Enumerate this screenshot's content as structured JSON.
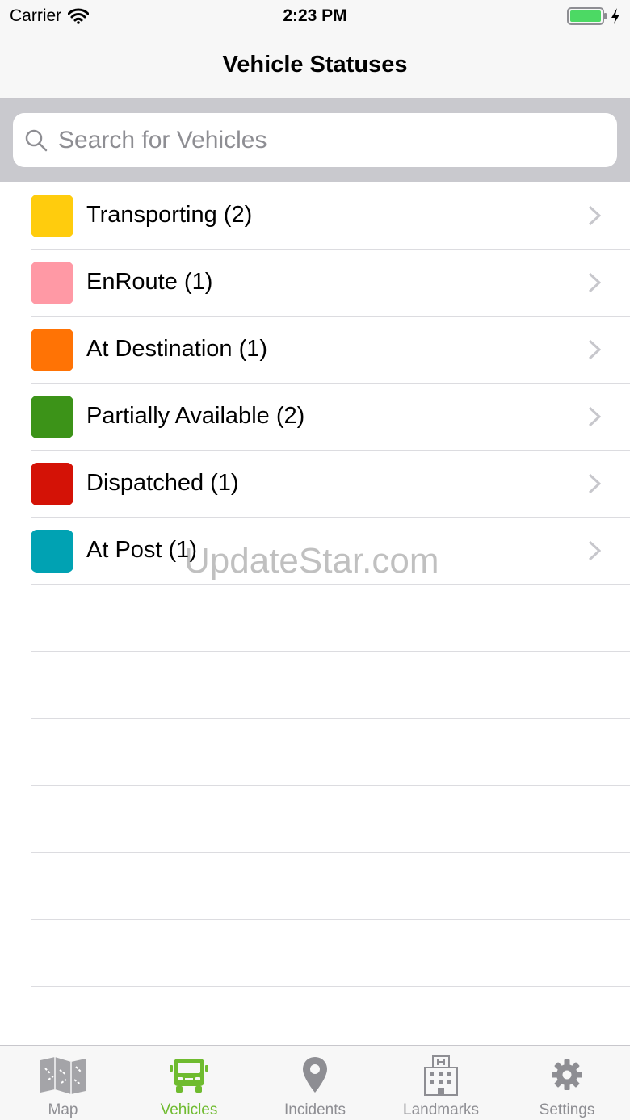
{
  "status_bar": {
    "carrier": "Carrier",
    "time": "2:23 PM"
  },
  "nav": {
    "title": "Vehicle Statuses"
  },
  "search": {
    "placeholder": "Search for Vehicles",
    "value": ""
  },
  "statuses": [
    {
      "label": "Transporting (2)",
      "color": "#ffcc0d"
    },
    {
      "label": "EnRoute (1)",
      "color": "#ff99a5"
    },
    {
      "label": "At Destination (1)",
      "color": "#ff7305"
    },
    {
      "label": "Partially Available (2)",
      "color": "#3c9318"
    },
    {
      "label": "Dispatched (1)",
      "color": "#d41206"
    },
    {
      "label": "At Post (1)",
      "color": "#00a2b3"
    }
  ],
  "watermark": "UpdateStar.com",
  "tabs": [
    {
      "label": "Map",
      "icon": "map-icon"
    },
    {
      "label": "Vehicles",
      "icon": "truck-icon",
      "active": true
    },
    {
      "label": "Incidents",
      "icon": "location-pin-icon"
    },
    {
      "label": "Landmarks",
      "icon": "hospital-building-icon"
    },
    {
      "label": "Settings",
      "icon": "gear-icon"
    }
  ],
  "colors": {
    "accent": "#6fbb2f",
    "inactive": "#8e8e93",
    "battery": "#4cd964"
  }
}
